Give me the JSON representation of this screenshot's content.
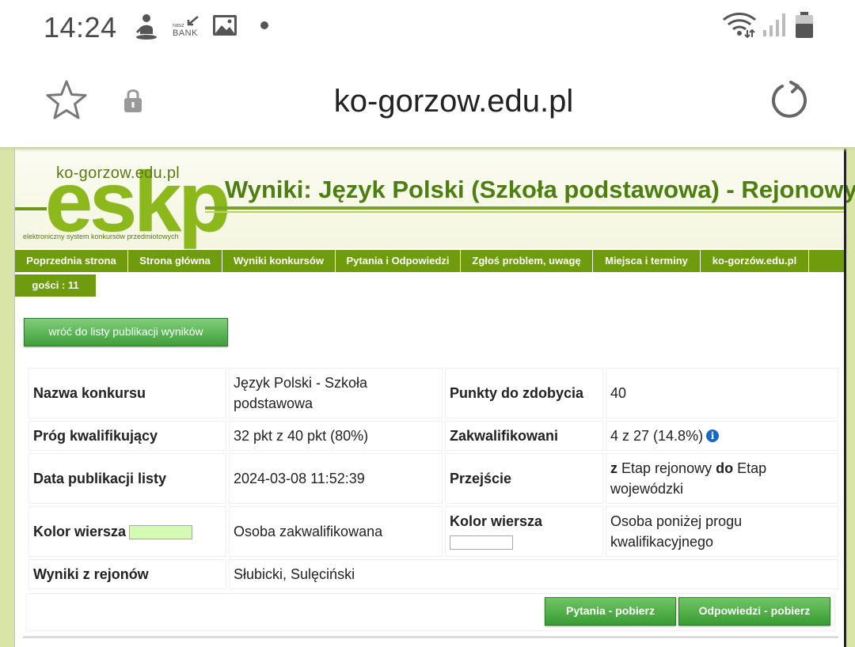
{
  "status_bar": {
    "time": "14:24",
    "icons": [
      "figure-notification-icon",
      "nasz-bank-icon",
      "image-icon",
      "dot-icon",
      "wifi-icon",
      "signal-icon",
      "battery-icon"
    ],
    "nasz": "nasz",
    "bank": "BANK"
  },
  "browser": {
    "url": "ko-gorzow.edu.pl"
  },
  "header": {
    "logo_domain": "ko-gorzow.edu.pl",
    "logo_letters": "eskp",
    "logo_tagline": "elektroniczny system konkursów przedmiotowych",
    "title": "Wyniki: Język Polski (Szkoła podstawowa) - Rejonowy"
  },
  "nav": {
    "items": [
      "Poprzednia strona",
      "Strona główna",
      "Wyniki konkursów",
      "Pytania i Odpowiedzi",
      "Zgłoś problem, uwagę",
      "Miejsca i terminy",
      "ko-gorzów.edu.pl"
    ],
    "guests": "gości : 11"
  },
  "back_button": "wróć do listy publikacji wyników",
  "info": {
    "name_label": "Nazwa konkursu",
    "name_value": "Język Polski - Szkoła podstawowa",
    "points_label": "Punkty do zdobycia",
    "points_value": "40",
    "threshold_label": "Próg kwalifikujący",
    "threshold_value": "32 pkt z 40 pkt (80%)",
    "qualified_label": "Zakwalifikowani",
    "qualified_value": "4 z 27 (14.8%)",
    "date_label": "Data publikacji listy",
    "date_value": "2024-03-08 11:52:39",
    "transition_label": "Przejście",
    "transition_z": "z",
    "transition_from": "Etap rejonowy",
    "transition_do": "do",
    "transition_to": "Etap wojewódzki",
    "row_color_label": "Kolor wiersza",
    "row_color_qualified_text": "Osoba zakwalifikowana",
    "row_color_below_text": "Osoba poniżej progu kwalifikacyjnego",
    "regions_label": "Wyniki z rejonów",
    "regions_value": "Słubicki, Sulęciński",
    "info_icon_glyph": "i"
  },
  "colors": {
    "qualified_row": "#d4fbb4",
    "below_row": "#ffffff",
    "nav_green": "#6e9c0c",
    "title_green": "#4d7f10",
    "button_green": "#3f9e3a",
    "page_bg": "#d9e5a7"
  },
  "buttons": {
    "questions": "Pytania - pobierz",
    "answers": "Odpowiedzi - pobierz"
  }
}
